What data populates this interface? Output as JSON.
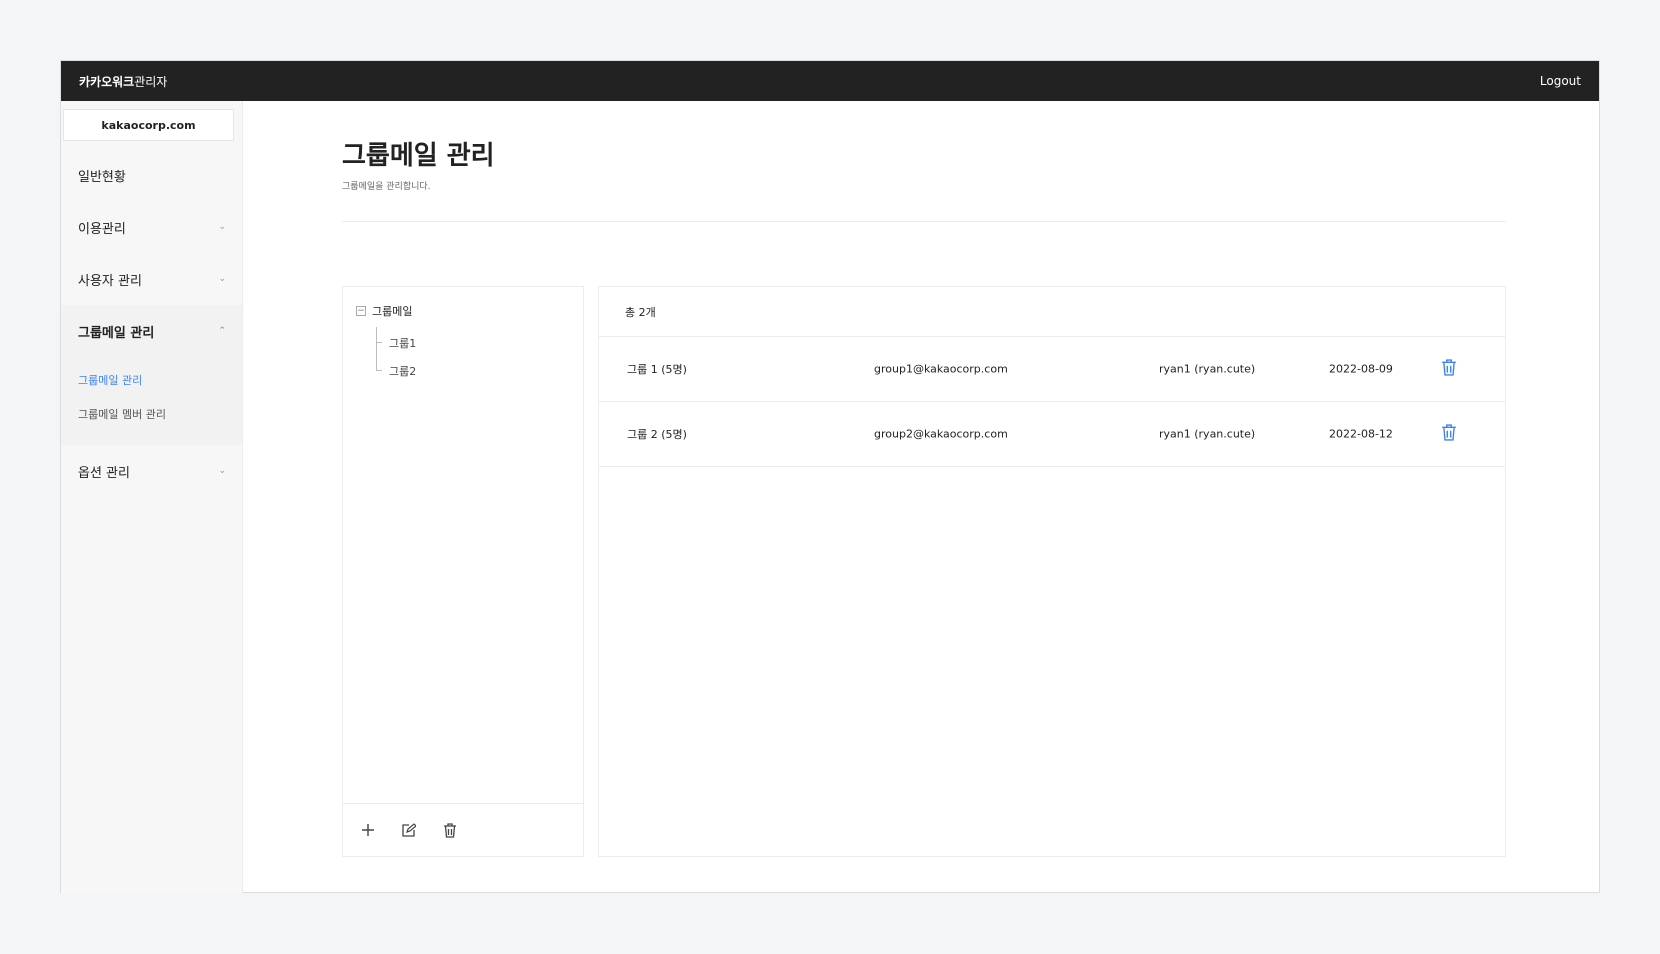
{
  "header": {
    "brand_bold": "카카오워크",
    "brand_rest": "관리자",
    "logout_label": "Logout"
  },
  "sidebar": {
    "domain": "kakaocorp.com",
    "items": [
      {
        "label": "일반현황"
      },
      {
        "label": "이용관리"
      },
      {
        "label": "사용자 관리"
      },
      {
        "label": "그룹메일 관리"
      },
      {
        "label": "옵션 관리"
      }
    ],
    "subitems": [
      {
        "label": "그룹메일 관리"
      },
      {
        "label": "그룹메일 멤버 관리"
      }
    ],
    "chevron_down": "⌄",
    "chevron_up": "⌃"
  },
  "page": {
    "title": "그룹메일 관리",
    "description": "그룹메일을 관리합니다."
  },
  "tree": {
    "root": "그룹메일",
    "collapse_symbol": "−",
    "children": [
      {
        "label": "그룹1"
      },
      {
        "label": "그룹2"
      }
    ]
  },
  "list": {
    "total": "총 2개",
    "rows": [
      {
        "name": "그룹 1 (5명)",
        "email": "group1@kakaocorp.com",
        "owner": "ryan1 (ryan.cute)",
        "date": "2022-08-09"
      },
      {
        "name": "그룹 2 (5명)",
        "email": "group2@kakaocorp.com",
        "owner": "ryan1 (ryan.cute)",
        "date": "2022-08-12"
      }
    ]
  },
  "colors": {
    "topbar": "#222222",
    "accent": "#3b82f6"
  },
  "icons": {
    "add": "plus-icon",
    "edit": "edit-icon",
    "delete": "trash-icon"
  }
}
